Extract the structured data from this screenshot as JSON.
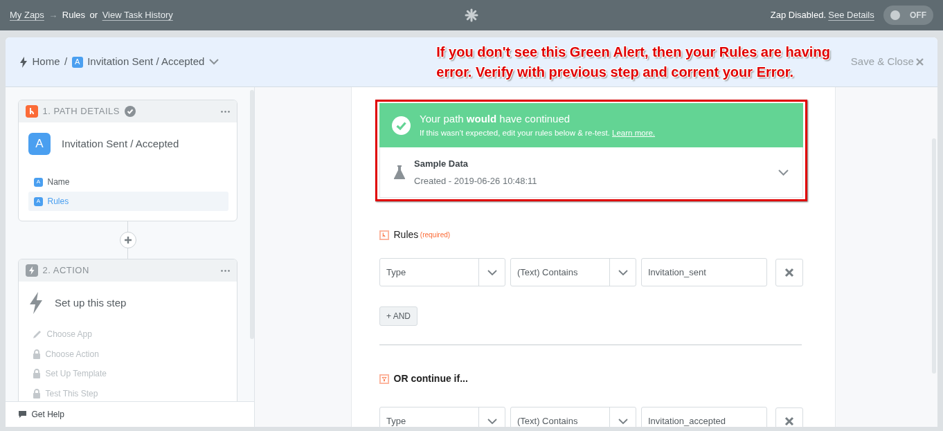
{
  "top_bar": {
    "breadcrumb": [
      {
        "kind": "link",
        "text": "My Zaps"
      },
      {
        "kind": "separator",
        "text": "→"
      },
      {
        "kind": "current",
        "text": "Rules"
      },
      {
        "kind": "plain",
        "text": "or"
      },
      {
        "kind": "link",
        "text": "View Task History"
      }
    ],
    "status": "Zap Disabled.",
    "status_link": "See Details",
    "toggle": {
      "label": "OFF",
      "on": false
    }
  },
  "header": {
    "home": "Home",
    "separator": "/",
    "path_badge": "A",
    "path_name": "Invitation Sent / Accepted",
    "save_close": "Save & Close"
  },
  "annotation": {
    "lines": [
      "If you don't see this Green Alert, then your Rules are having",
      "error. Verify with previous step and corrent your Error."
    ]
  },
  "sidebar": {
    "steps": [
      {
        "kind": "path",
        "heading": "1. PATH DETAILS",
        "completed": true,
        "badge": "A",
        "title": "Invitation Sent / Accepted",
        "items": [
          {
            "kind": "badge",
            "badge": "A",
            "label": "Name",
            "selected": false
          },
          {
            "kind": "badge",
            "badge": "A",
            "label": "Rules",
            "selected": true
          }
        ]
      },
      {
        "kind": "action",
        "heading": "2. ACTION",
        "completed": false,
        "title": "Set up this step",
        "items": [
          {
            "kind": "edit",
            "label": "Choose App",
            "selected": false
          },
          {
            "kind": "locked",
            "label": "Choose Action",
            "selected": false
          },
          {
            "kind": "locked",
            "label": "Set Up Template",
            "selected": false
          },
          {
            "kind": "locked",
            "label": "Test This Step",
            "selected": false
          }
        ]
      }
    ],
    "help": "Get Help"
  },
  "alert": {
    "title": "Your path **would** have continued",
    "detail": "If this wasn’t expected, edit your rules below & re-test.",
    "link": "Learn more."
  },
  "sample": {
    "title": "Sample Data",
    "subtitle": "Created - 2019-06-26 10:48:11"
  },
  "rule_groups": [
    {
      "kind": "rules",
      "title": "Rules",
      "required": "(required)",
      "rows": [
        {
          "field": "Type",
          "operator": "(Text) Contains",
          "value": "Invitation_sent"
        }
      ],
      "and_button": "+ AND"
    },
    {
      "kind": "or",
      "title": "OR continue if...",
      "rows": [
        {
          "field": "Type",
          "operator": "(Text) Contains",
          "value": "Invitation_accepted"
        }
      ]
    }
  ]
}
